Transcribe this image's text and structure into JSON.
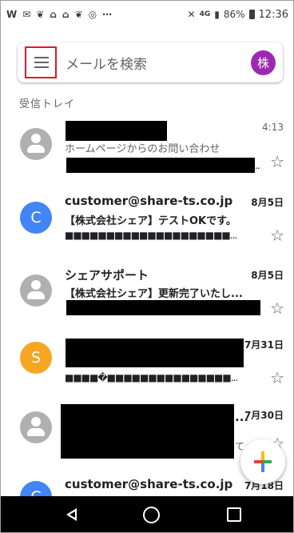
{
  "status_bar": {
    "left_icons": [
      "W",
      "✉",
      "❦",
      "⌂",
      "⌂",
      "❦",
      "◎",
      "⋯"
    ],
    "network": "4G",
    "battery": "86%",
    "time": "12:36"
  },
  "search": {
    "placeholder": "メールを検索",
    "avatar_letter": "株"
  },
  "section_label": "受信トレイ",
  "emails": [
    {
      "sender": "",
      "date": "4:13",
      "subject": "ホームページからのお問い合わせ",
      "snippet": "",
      "avatar": "person",
      "read": true
    },
    {
      "sender": "customer@share-ts.co.jp",
      "date": "8月5日",
      "subject": "【株式会社シェア】テストOKです。",
      "snippet": "■■■■■■■■■■■■■■■■■■■■...",
      "avatar": "C",
      "avatar_color": "#4285f4",
      "read": false
    },
    {
      "sender": "シェアサポート",
      "date": "8月5日",
      "subject": "【株式会社シェア】更新完了いたし...",
      "snippet": "",
      "avatar": "person",
      "read": false
    },
    {
      "sender": "",
      "date": "7月31日",
      "subject": "",
      "snippet": "■■■■�■■■■■■■■■■■■■■■...",
      "avatar": "S",
      "avatar_color": "#f6a623",
      "read": false
    },
    {
      "sender": "...",
      "date": "7月30日",
      "subject": "",
      "snippet": "て",
      "avatar": "person",
      "read": false
    },
    {
      "sender": "customer@share-ts.co.jp",
      "date": "7月18日",
      "avatar": "C",
      "avatar_color": "#4285f4",
      "read": false
    }
  ],
  "colors": {
    "accent_red": "#e0182d",
    "compose_red": "#ea4335",
    "compose_green": "#34a853",
    "compose_yellow": "#fbbc04",
    "compose_blue": "#4285f4",
    "avatar_purple": "#9c2ab0"
  },
  "icons": {
    "menu": "hamburger-menu-icon",
    "star": "star-icon",
    "compose": "compose-plus-icon",
    "nav_back": "back-triangle-icon",
    "nav_home": "home-circle-icon",
    "nav_recent": "recents-square-icon"
  }
}
